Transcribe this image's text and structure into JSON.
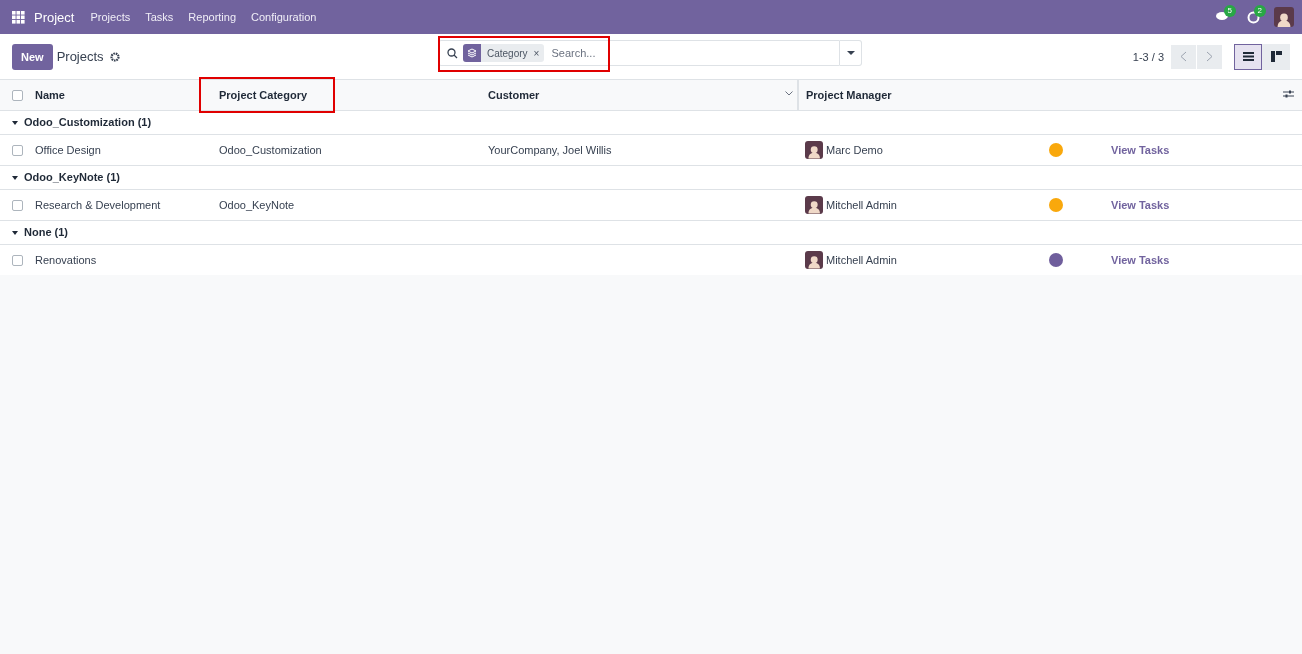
{
  "navbar": {
    "app": "Project",
    "menu": [
      "Projects",
      "Tasks",
      "Reporting",
      "Configuration"
    ],
    "messages_count": "5",
    "activities_count": "2"
  },
  "control_panel": {
    "new_button": "New",
    "breadcrumb": "Projects",
    "search": {
      "facet": "Category",
      "facet_remove": "×",
      "placeholder": "Search...",
      "highlighted": true
    },
    "pager": "1-3 / 3",
    "views": [
      {
        "kind": "list",
        "selected": true
      },
      {
        "kind": "kanban",
        "selected": false
      }
    ]
  },
  "table": {
    "select_all_checked": false,
    "columns": [
      {
        "label": "Name",
        "highlighted": false
      },
      {
        "label": "Project Category",
        "highlighted": true
      },
      {
        "label": "Customer",
        "highlighted": false
      },
      {
        "label": "Project Manager",
        "highlighted": false
      }
    ],
    "groups": [
      {
        "label": "Odoo_Customization (1)",
        "expanded": true,
        "rows": [
          {
            "checked": false,
            "name": "Office Design",
            "category": "Odoo_Customization",
            "customer": "YourCompany, Joel Willis",
            "manager": "Marc Demo",
            "color": "#f9a80c",
            "link": "View Tasks"
          }
        ]
      },
      {
        "label": "Odoo_KeyNote (1)",
        "expanded": true,
        "rows": [
          {
            "checked": false,
            "name": "Research & Development",
            "category": "Odoo_KeyNote",
            "customer": "",
            "manager": "Mitchell Admin",
            "color": "#f9a80c",
            "link": "View Tasks"
          }
        ]
      },
      {
        "label": "None (1)",
        "expanded": true,
        "rows": [
          {
            "checked": false,
            "name": "Renovations",
            "category": "",
            "customer": "",
            "manager": "Mitchell Admin",
            "color": "#6f5e9c",
            "link": "View Tasks"
          }
        ]
      }
    ]
  }
}
